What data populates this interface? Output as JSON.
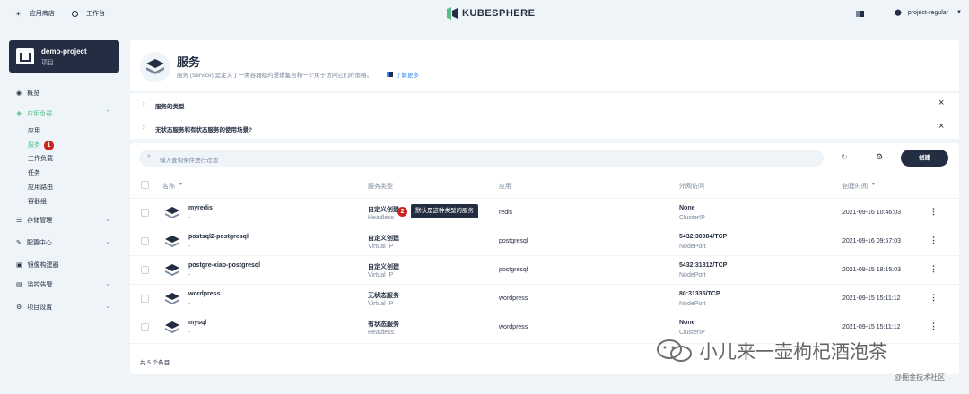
{
  "topbar": {
    "app_store": "应用商店",
    "workbench": "工作台",
    "brand": "KUBESPHERE",
    "user": "project-regular"
  },
  "sidebar": {
    "project_name": "demo-project",
    "project_type": "项目",
    "overview": "概览",
    "workloads": "应用负载",
    "sub_items": [
      "应用",
      "服务",
      "工作负载",
      "任务",
      "应用路由",
      "容器组"
    ],
    "badge_1": "1",
    "storage": "存储管理",
    "config": "配置中心",
    "image_builder": "镜像构建器",
    "monitoring": "监控告警",
    "settings": "项目设置"
  },
  "header": {
    "title": "服务",
    "description": "服务 (Service) 是定义了一类容器组的逻辑集合和一个用于访问它们的策略。",
    "learn_more": "了解更多"
  },
  "accordions": [
    "服务的类型",
    "无状态服务和有状态服务的使用场景?"
  ],
  "toolbar": {
    "search_placeholder": "输入查询条件进行过滤",
    "create": "创建"
  },
  "table": {
    "headers": {
      "name": "名称",
      "service_type": "服务类型",
      "app": "应用",
      "external_access": "外网访问",
      "created": "创建时间"
    },
    "rows": [
      {
        "name": "myredis",
        "desc": "-",
        "type": "自定义创建",
        "type_sub": "Headless",
        "app": "redis",
        "ext": "None",
        "ext_sub": "ClusterIP",
        "time": "2021-09-16 10:46:03"
      },
      {
        "name": "postsql2-postgresql",
        "desc": "-",
        "type": "自定义创建",
        "type_sub": "Virtual IP",
        "app": "postgresql",
        "ext": "5432:30984/TCP",
        "ext_sub": "NodePort",
        "time": "2021-09-16 09:57:03"
      },
      {
        "name": "postgre-xiao-postgresql",
        "desc": "-",
        "type": "自定义创建",
        "type_sub": "Virtual IP",
        "app": "postgresql",
        "ext": "5432:31812/TCP",
        "ext_sub": "NodePort",
        "time": "2021-09-15 18:15:03"
      },
      {
        "name": "wordpress",
        "desc": "-",
        "type": "无状态服务",
        "type_sub": "Virtual IP",
        "app": "wordpress",
        "ext": "80:31335/TCP",
        "ext_sub": "NodePort",
        "time": "2021-09-15 15:11:12"
      },
      {
        "name": "mysql",
        "desc": "-",
        "type": "有状态服务",
        "type_sub": "Headless",
        "app": "wordpress",
        "ext": "None",
        "ext_sub": "ClusterIP",
        "time": "2021-09-15 15:11:12"
      }
    ],
    "total": "共 5 个条目"
  },
  "tooltip": {
    "badge": "2",
    "text": "默认是这种类型的服务"
  },
  "watermark": {
    "main": "小儿来一壶枸杞酒泡茶",
    "sub": "@掘金技术社区"
  },
  "colors": {
    "accent": "#55bc8a",
    "dark": "#242e42",
    "badge": "#ca2621",
    "background": "#eff4f9"
  }
}
